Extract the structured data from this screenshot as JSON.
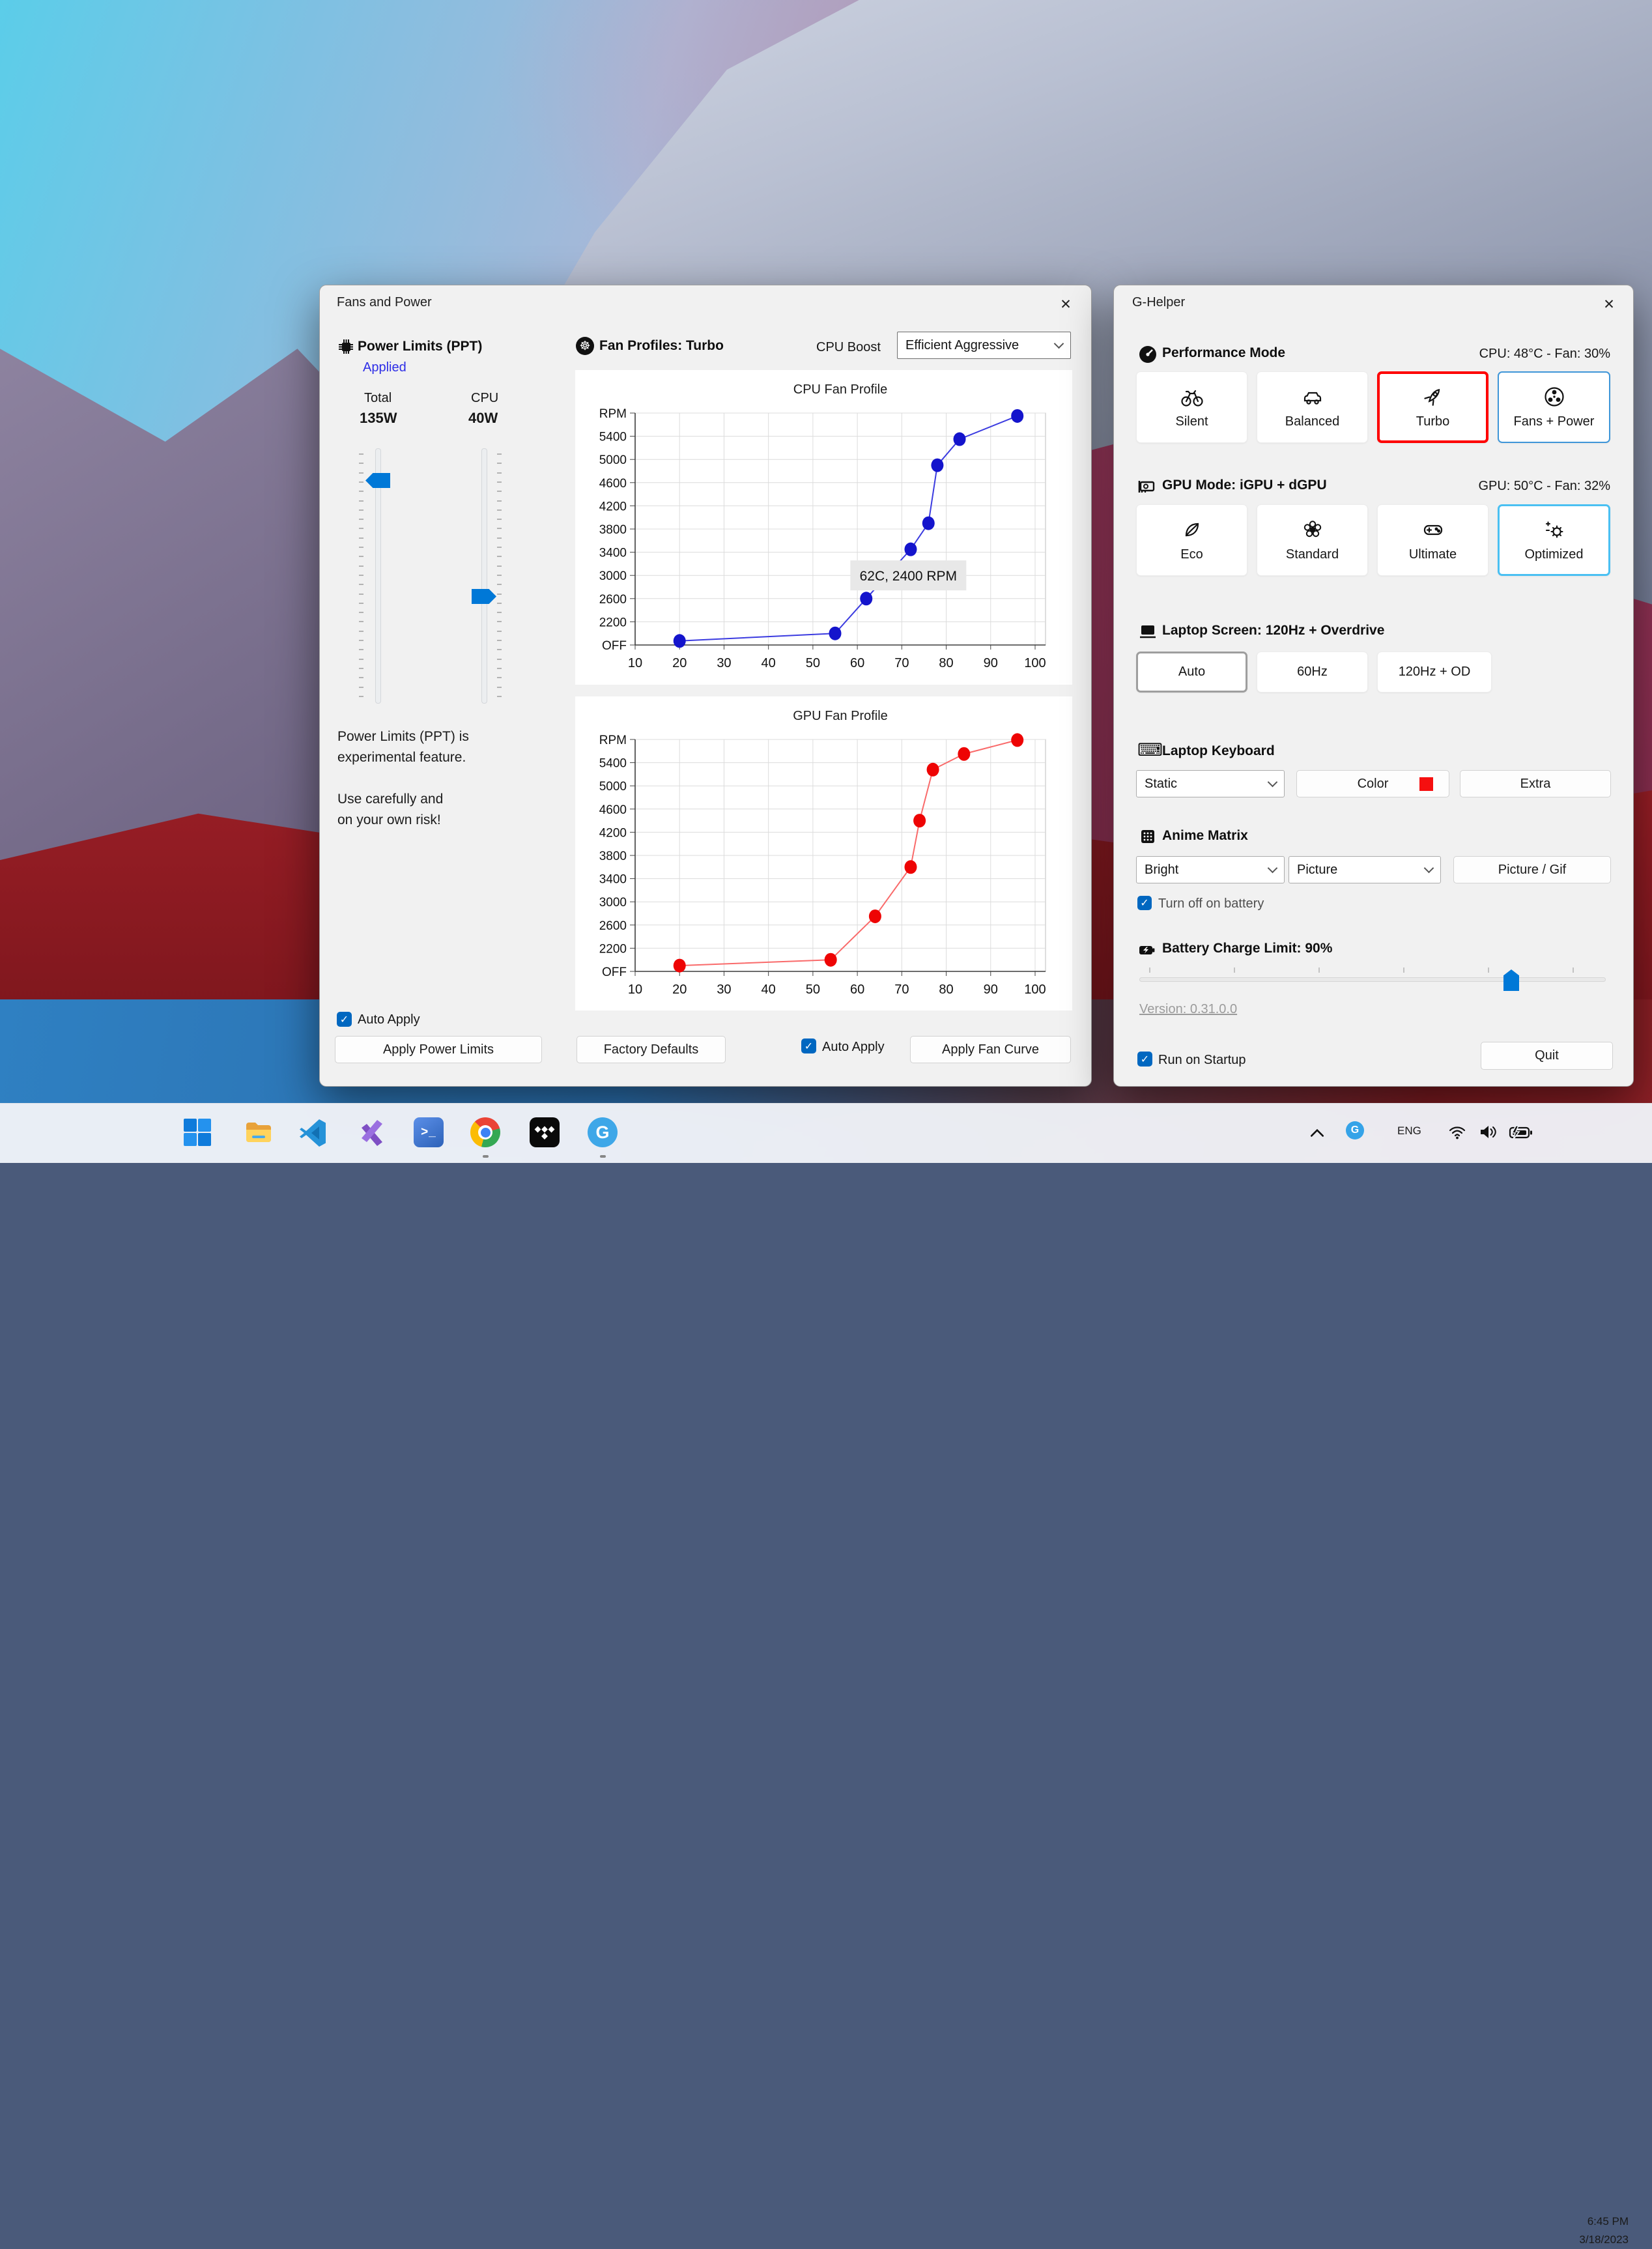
{
  "colors": {
    "accent_blue": "#0078d4",
    "checkbox_blue": "#0067c0",
    "turbo_border_red": "#fe0000",
    "optimized_border_blue": "#4ac0f2",
    "applied_text_blue": "#2d2de6",
    "keyboard_swatch_red": "#f50f0f",
    "cpu_curve_blue": "#1414cc",
    "gpu_curve_red": "#ee0404"
  },
  "icons": {
    "close": "✕",
    "check": "✓",
    "fan": "☸",
    "keyboard": "⌨",
    "powershell_glyph": ">_",
    "ghelper_letter": "G"
  },
  "fans_window": {
    "title": "Fans and Power",
    "power_limits": {
      "header": "Power Limits (PPT)",
      "status": "Applied",
      "total_label": "Total",
      "total_value": "135W",
      "cpu_label": "CPU",
      "cpu_value": "40W",
      "note_line1": "Power Limits (PPT) is",
      "note_line2": "experimental feature.",
      "note_line3": "Use carefully and",
      "note_line4": "on your own risk!",
      "auto_apply_label": "Auto Apply",
      "apply_button": "Apply Power Limits"
    },
    "fan_profiles": {
      "header": "Fan Profiles: Turbo",
      "cpu_boost_label": "CPU Boost",
      "cpu_boost_value": "Efficient Aggressive",
      "factory_defaults_button": "Factory Defaults",
      "auto_apply_label": "Auto Apply",
      "apply_button": "Apply Fan Curve"
    }
  },
  "chart_data": [
    {
      "type": "line",
      "title": "CPU Fan Profile",
      "xlabel": "",
      "ylabel": "RPM",
      "x_ticks": [
        10,
        20,
        30,
        40,
        50,
        60,
        70,
        80,
        90,
        100
      ],
      "xlim": [
        10,
        100
      ],
      "grid": true,
      "y_axis": {
        "base_rpm": 1800,
        "step": 400,
        "tick_labels": [
          "OFF",
          "2200",
          "2600",
          "3000",
          "3400",
          "3800",
          "4200",
          "4600",
          "5000",
          "5400",
          "RPM"
        ]
      },
      "series": [
        {
          "name": "CPU fan curve",
          "line_color": "#3b3be0",
          "marker_color": "#1414cc",
          "points": [
            [
              20,
              1870
            ],
            [
              55,
              2000
            ],
            [
              62,
              2600
            ],
            [
              72,
              3450
            ],
            [
              76,
              3900
            ],
            [
              78,
              4900
            ],
            [
              83,
              5350
            ],
            [
              96,
              5750
            ]
          ]
        }
      ],
      "annotation": {
        "text": "62C, 2400 RPM",
        "anchor_x": 70,
        "anchor_y": 3000
      }
    },
    {
      "type": "line",
      "title": "GPU Fan Profile",
      "xlabel": "",
      "ylabel": "RPM",
      "x_ticks": [
        10,
        20,
        30,
        40,
        50,
        60,
        70,
        80,
        90,
        100
      ],
      "xlim": [
        10,
        100
      ],
      "grid": true,
      "y_axis": {
        "base_rpm": 1800,
        "step": 400,
        "tick_labels": [
          "OFF",
          "2200",
          "2600",
          "3000",
          "3400",
          "3800",
          "4200",
          "4600",
          "5000",
          "5400",
          "RPM"
        ]
      },
      "series": [
        {
          "name": "GPU fan curve",
          "line_color": "#f96a6a",
          "marker_color": "#ee0404",
          "points": [
            [
              20,
              1900
            ],
            [
              54,
              2000
            ],
            [
              64,
              2750
            ],
            [
              72,
              3600
            ],
            [
              74,
              4400
            ],
            [
              77,
              5280
            ],
            [
              84,
              5550
            ],
            [
              96,
              5790
            ]
          ]
        }
      ]
    }
  ],
  "ghelper_window": {
    "title": "G-Helper",
    "performance": {
      "header": "Performance Mode",
      "status": "CPU: 48°C -  Fan: 30%",
      "buttons": [
        {
          "label": "Silent"
        },
        {
          "label": "Balanced"
        },
        {
          "label": "Turbo",
          "selected": true
        },
        {
          "label": "Fans + Power",
          "highlighted": true
        }
      ]
    },
    "gpu": {
      "header": "GPU Mode: iGPU + dGPU",
      "status": "GPU: 50°C -  Fan: 32%",
      "buttons": [
        {
          "label": "Eco"
        },
        {
          "label": "Standard"
        },
        {
          "label": "Ultimate"
        },
        {
          "label": "Optimized",
          "selected": true
        }
      ]
    },
    "screen": {
      "header": "Laptop Screen: 120Hz + Overdrive",
      "buttons": [
        {
          "label": "Auto",
          "selected": true
        },
        {
          "label": "60Hz"
        },
        {
          "label": "120Hz + OD"
        }
      ]
    },
    "keyboard": {
      "header": "Laptop Keyboard",
      "mode_value": "Static",
      "color_button": "Color",
      "extra_button": "Extra"
    },
    "anime_matrix": {
      "header": "Anime Matrix",
      "brightness_value": "Bright",
      "mode_value": "Picture",
      "picture_gif_button": "Picture / Gif",
      "battery_checkbox_label": "Turn off on battery",
      "battery_checkbox_checked": true
    },
    "battery": {
      "header": "Battery Charge Limit: 90%",
      "value_percent": 90
    },
    "version_link": "Version: 0.31.0.0",
    "run_on_startup_label": "Run on Startup",
    "run_on_startup_checked": true,
    "quit_button": "Quit"
  },
  "taskbar": {
    "pinned_apps": [
      "start",
      "file-explorer",
      "vscode",
      "visual-studio",
      "powershell",
      "chrome",
      "tidal",
      "g-helper"
    ],
    "running_apps": [
      "chrome",
      "g-helper"
    ],
    "tray": {
      "language": "ENG",
      "time": "6:45 PM",
      "date": "3/18/2023"
    }
  }
}
